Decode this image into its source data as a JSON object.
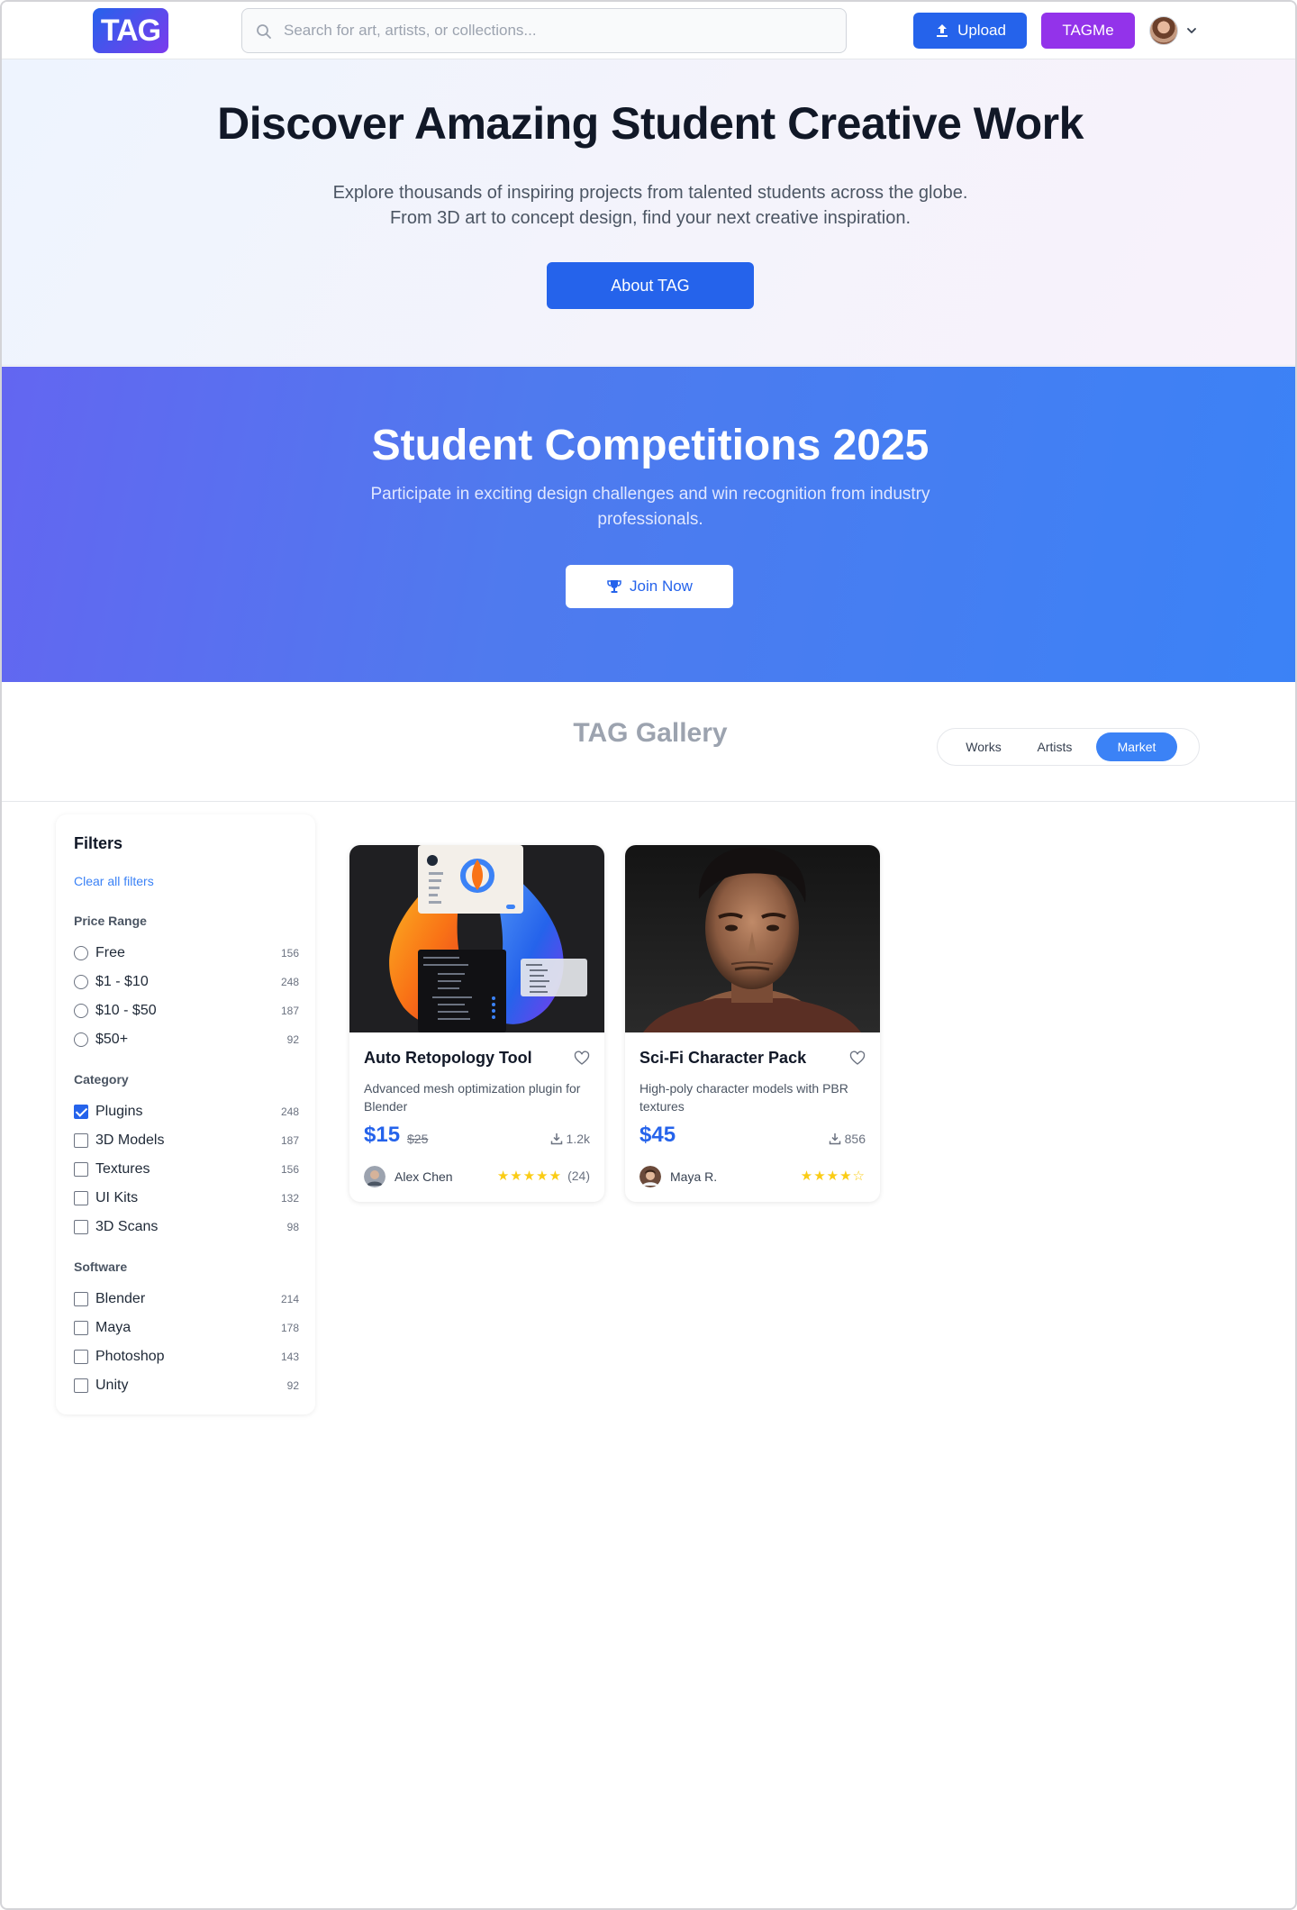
{
  "header": {
    "logo": "TAG",
    "search_placeholder": "Search for art, artists, or collections...",
    "upload_label": "Upload",
    "tagme_label": "TAGMe"
  },
  "hero": {
    "title": "Discover Amazing Student Creative Work",
    "subtitle_line1": "Explore thousands of inspiring projects from talented students across the globe.",
    "subtitle_line2": "From 3D art to concept design, find your next creative inspiration.",
    "cta": "About TAG"
  },
  "competition": {
    "title": "Student Competitions 2025",
    "subtitle": "Participate in exciting design challenges and win recognition from industry professionals.",
    "cta": "Join Now"
  },
  "gallery": {
    "title": "TAG Gallery",
    "tabs": [
      "Works",
      "Artists",
      "Market"
    ],
    "active_tab": "Market"
  },
  "filters": {
    "title": "Filters",
    "clear_label": "Clear all filters",
    "price_range": {
      "label": "Price Range",
      "options": [
        {
          "label": "Free",
          "count": "156"
        },
        {
          "label": "$1 - $10",
          "count": "248"
        },
        {
          "label": "$10 - $50",
          "count": "187"
        },
        {
          "label": "$50+",
          "count": "92"
        }
      ]
    },
    "category": {
      "label": "Category",
      "options": [
        {
          "label": "Plugins",
          "count": "248",
          "checked": true
        },
        {
          "label": "3D Models",
          "count": "187"
        },
        {
          "label": "Textures",
          "count": "156"
        },
        {
          "label": "UI Kits",
          "count": "132"
        },
        {
          "label": "3D Scans",
          "count": "98"
        }
      ]
    },
    "software": {
      "label": "Software",
      "options": [
        {
          "label": "Blender",
          "count": "214"
        },
        {
          "label": "Maya",
          "count": "178"
        },
        {
          "label": "Photoshop",
          "count": "143"
        },
        {
          "label": "Unity",
          "count": "92"
        }
      ]
    }
  },
  "products": [
    {
      "title": "Auto Retopology Tool",
      "description": "Advanced mesh optimization plugin for Blender",
      "price": "$15",
      "old_price": "$25",
      "downloads": "1.2k",
      "author": "Alex Chen",
      "stars": "★★★★★",
      "rating_count": "(24)"
    },
    {
      "title": "Sci-Fi Character Pack",
      "description": "High-poly character models with PBR textures",
      "price": "$45",
      "downloads": "856",
      "author": "Maya R.",
      "stars": "★★★★☆"
    }
  ],
  "colors": {
    "primary": "#2563eb",
    "purple": "#9333ea",
    "star": "#facc15"
  }
}
